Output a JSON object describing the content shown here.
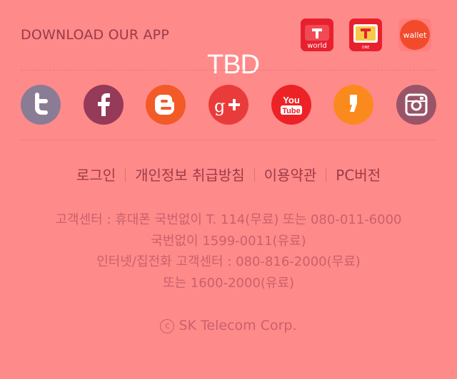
{
  "app": {
    "download_title": "DOWNLOAD OUR APP",
    "apps": [
      {
        "name": "tworld-app-icon",
        "label": "world",
        "color": "#e8202e"
      },
      {
        "name": "tstore-app-icon",
        "label": "ONE",
        "color": "#e8202e"
      },
      {
        "name": "wallet-app-icon",
        "label": "wallet",
        "color": "#f24b2c"
      }
    ]
  },
  "overlay": {
    "tbd": "TBD"
  },
  "social": {
    "items": [
      {
        "name": "twitter-icon",
        "color": "#8a7c94"
      },
      {
        "name": "facebook-icon",
        "color": "#953a58"
      },
      {
        "name": "blogger-icon",
        "color": "#f25a28"
      },
      {
        "name": "google-plus-icon",
        "color": "#ea3b3b"
      },
      {
        "name": "youtube-icon",
        "color": "#ed2226",
        "label_top": "You",
        "label_bottom": "Tube"
      },
      {
        "name": "kakao-story-icon",
        "color": "#fb8a1e"
      },
      {
        "name": "instagram-icon",
        "color": "#9a5468"
      }
    ]
  },
  "links": {
    "login": "로그인",
    "privacy": "개인정보 취급방침",
    "terms": "이용약관",
    "pc_version": "PC버전"
  },
  "contact": {
    "line1": "고객센터 : 휴대폰 국번없이 T. 114(무료) 또는 080-011-6000",
    "line2": "국번없이 1599-0011(유료)",
    "line3": "인터넷/집전화 고객센터 : 080-816-2000(무료)",
    "line4": "또는 1600-2000(유료)"
  },
  "footer": {
    "copyright_mark": "c",
    "copyright": "SK Telecom Corp."
  }
}
